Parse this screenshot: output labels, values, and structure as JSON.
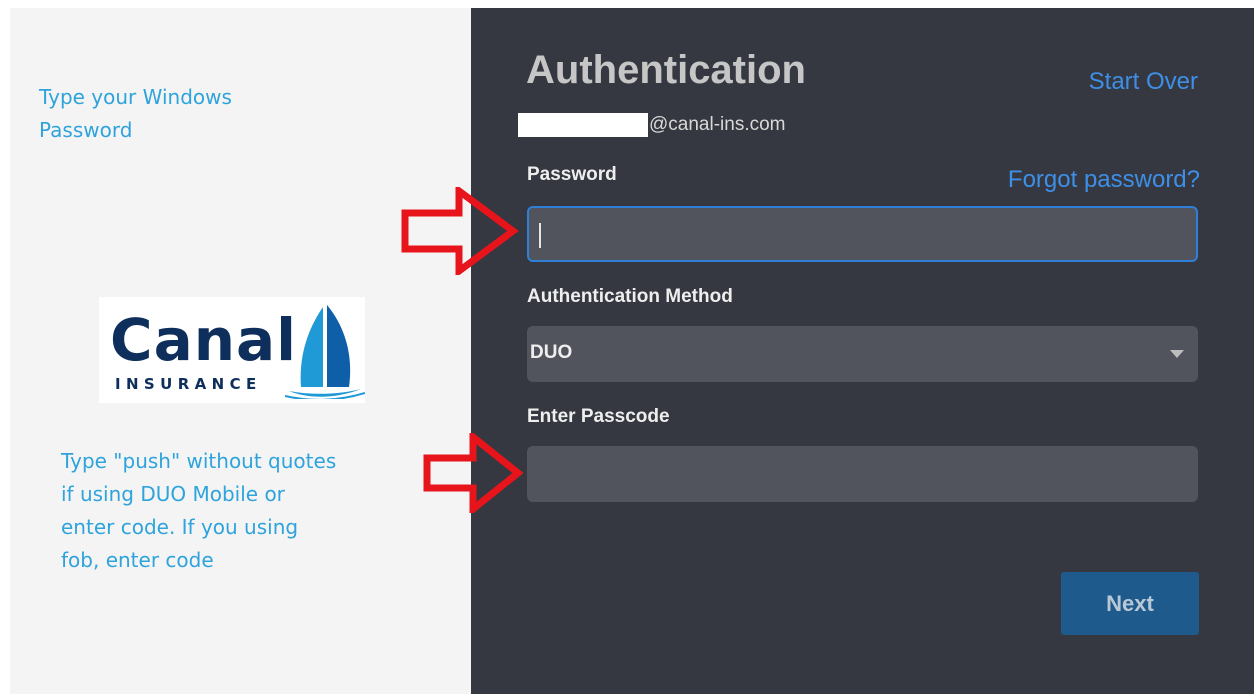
{
  "instructions": {
    "password_note": "Type your Windows Password",
    "passcode_note": "Type \"push\" without quotes if using DUO Mobile or enter code. If you using fob, enter code"
  },
  "logo": {
    "name": "Canal",
    "tagline": "INSURANCE"
  },
  "auth": {
    "title": "Authentication",
    "start_over": "Start Over",
    "user_domain": "@canal-ins.com",
    "password_label": "Password",
    "forgot_password": "Forgot password?",
    "password_value": "",
    "method_label": "Authentication Method",
    "method_value": "DUO",
    "passcode_label": "Enter Passcode",
    "passcode_value": "",
    "next_label": "Next"
  },
  "colors": {
    "dark_panel": "#353840",
    "link_blue": "#3d8fe8",
    "note_blue": "#2ea3dc",
    "arrow_red": "#e8141c",
    "button_blue": "#1f5a8c"
  }
}
